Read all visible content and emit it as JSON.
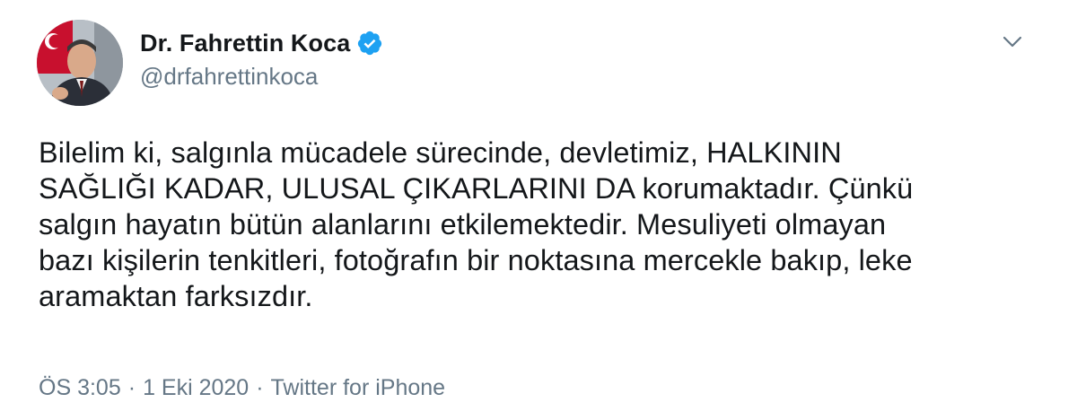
{
  "author": {
    "display_name": "Dr. Fahrettin Koca",
    "handle": "@drfahrettinkoca",
    "verified": true
  },
  "tweet": {
    "text": "Bilelim ki, salgınla mücadele sürecinde, devletimiz, HALKININ\nSAĞLIĞI KADAR, ULUSAL ÇIKARLARINI DA korumaktadır. Çünkü\nsalgın hayatın bütün alanlarını etkilemektedir. Mesuliyeti olmayan\nbazı kişilerin tenkitleri, fotoğrafın bir noktasına mercekle bakıp, leke\naramaktan farksızdır."
  },
  "meta": {
    "time": "ÖS 3:05",
    "separator": "·",
    "date": "1 Eki 2020",
    "source": "Twitter for iPhone"
  },
  "icons": {
    "verified": "verified-badge-icon",
    "caret": "chevron-down-icon"
  },
  "colors": {
    "verified_blue": "#1da1f2",
    "secondary_text": "#657786",
    "primary_text": "#14171a"
  }
}
